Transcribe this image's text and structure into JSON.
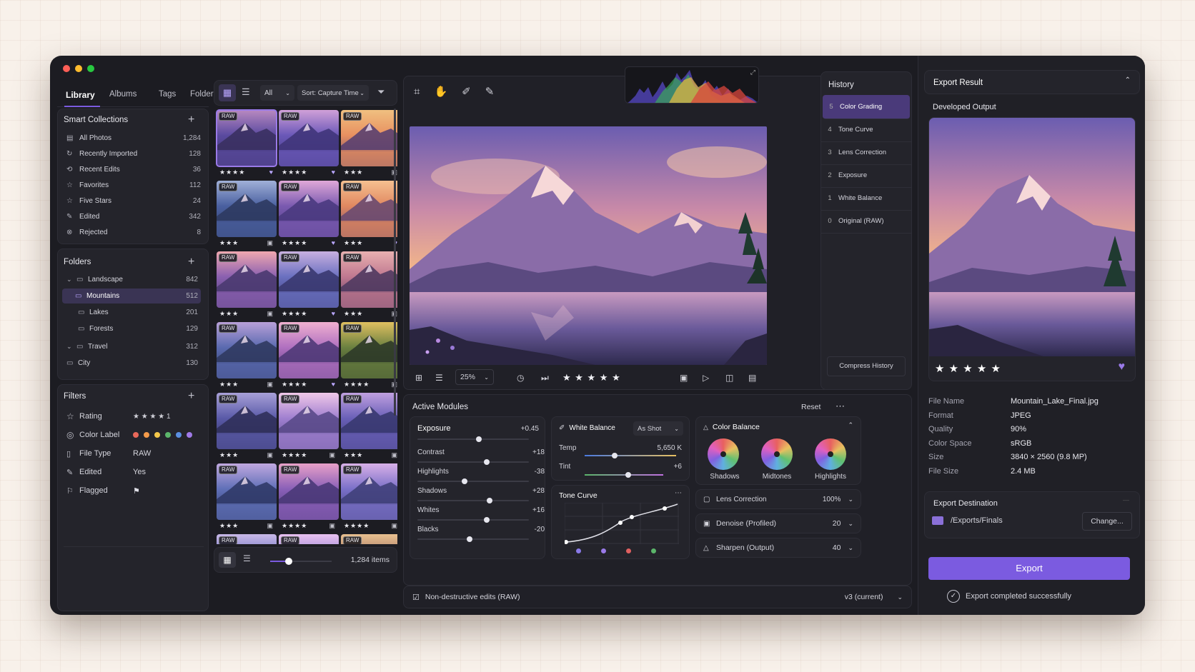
{
  "library": {
    "tabs": [
      "Library",
      "Albums",
      "Tags",
      "Folders"
    ]
  },
  "smart": {
    "title": "Smart Collections",
    "items": [
      {
        "label": "All Photos",
        "count": "1,284"
      },
      {
        "label": "Recently Imported",
        "count": "128"
      },
      {
        "label": "Recent Edits",
        "count": "36"
      },
      {
        "label": "Favorites",
        "count": "112"
      },
      {
        "label": "Five Stars",
        "count": "24"
      },
      {
        "label": "Edited",
        "count": "342"
      },
      {
        "label": "Rejected",
        "count": "8"
      }
    ]
  },
  "folders": {
    "title": "Folders",
    "items": [
      {
        "label": "Landscape",
        "count": "842"
      },
      {
        "label": "Mountains",
        "count": "512"
      },
      {
        "label": "Lakes",
        "count": "201"
      },
      {
        "label": "Forests",
        "count": "129"
      },
      {
        "label": "Travel",
        "count": "312"
      },
      {
        "label": "City",
        "count": "130"
      }
    ]
  },
  "filters": {
    "title": "Filters",
    "rating": "Rating",
    "color_label": "Color Label",
    "file_type": "File Type",
    "file_type_val": "RAW",
    "edited": "Edited",
    "edited_val": "Yes",
    "flagged": "Flagged",
    "rating_stars": "★ ★ ★ ★ 1",
    "label_colors": [
      "#e8685a",
      "#f39a4a",
      "#f3c74a",
      "#5bb56a",
      "#5a8fe0",
      "#a07ae8"
    ]
  },
  "grid": {
    "filter": "All",
    "sort": "Sort: Capture Time",
    "raw": "RAW",
    "count": "1,284 items",
    "stars4": "★★★★",
    "stars3": "★★★",
    "zoom_slider": 0.3
  },
  "viewer": {
    "zoom": "25%",
    "stars": "★ ★ ★ ★ ★"
  },
  "history": {
    "title": "History",
    "items": [
      {
        "n": "5",
        "label": "Color Grading"
      },
      {
        "n": "4",
        "label": "Tone Curve"
      },
      {
        "n": "3",
        "label": "Lens Correction"
      },
      {
        "n": "2",
        "label": "Exposure"
      },
      {
        "n": "1",
        "label": "White Balance"
      },
      {
        "n": "0",
        "label": "Original (RAW)"
      }
    ],
    "compress": "Compress History"
  },
  "modules": {
    "title": "Active Modules",
    "reset": "Reset",
    "exposure": {
      "title": "Exposure",
      "value": "+0.45",
      "pos": 0.55
    },
    "sliders": [
      {
        "label": "Contrast",
        "value": "+18",
        "pos": 0.62
      },
      {
        "label": "Highlights",
        "value": "-38",
        "pos": 0.42
      },
      {
        "label": "Shadows",
        "value": "+28",
        "pos": 0.65
      },
      {
        "label": "Whites",
        "value": "+16",
        "pos": 0.62
      },
      {
        "label": "Blacks",
        "value": "-20",
        "pos": 0.47
      }
    ],
    "wb": {
      "title": "White Balance",
      "mode": "As Shot",
      "temp_label": "Temp",
      "temp_val": "5,650 K",
      "temp_pos": 0.33,
      "tint_label": "Tint",
      "tint_val": "+6",
      "tint_pos": 0.55
    },
    "tone": {
      "title": "Tone Curve"
    },
    "cb": {
      "title": "Color Balance",
      "wheels": [
        "Shadows",
        "Midtones",
        "Highlights"
      ]
    },
    "lens": {
      "label": "Lens Correction",
      "value": "100%"
    },
    "denoise": {
      "label": "Denoise (Profiled)",
      "value": "20"
    },
    "sharpen": {
      "label": "Sharpen (Output)",
      "value": "40"
    },
    "footer": "Non-destructive edits (RAW)",
    "version": "v3 (current)"
  },
  "export": {
    "title": "Export Result",
    "subtitle": "Developed Output",
    "stars": "★ ★ ★ ★ ★",
    "meta": [
      {
        "k": "File Name",
        "v": "Mountain_Lake_Final.jpg"
      },
      {
        "k": "Format",
        "v": "JPEG"
      },
      {
        "k": "Quality",
        "v": "90%"
      },
      {
        "k": "Color Space",
        "v": "sRGB"
      },
      {
        "k": "Size",
        "v": "3840 × 2560 (9.8 MP)"
      },
      {
        "k": "File Size",
        "v": "2.4 MB"
      }
    ],
    "dest_title": "Export Destination",
    "dest_path": "/Exports/Finals",
    "change": "Change...",
    "button": "Export",
    "done": "Export completed successfully"
  },
  "colors": {
    "accent": "#7b5be0",
    "accent_soft": "#4a3a7a",
    "bg": "#1c1c22",
    "panel": "#24242b"
  }
}
